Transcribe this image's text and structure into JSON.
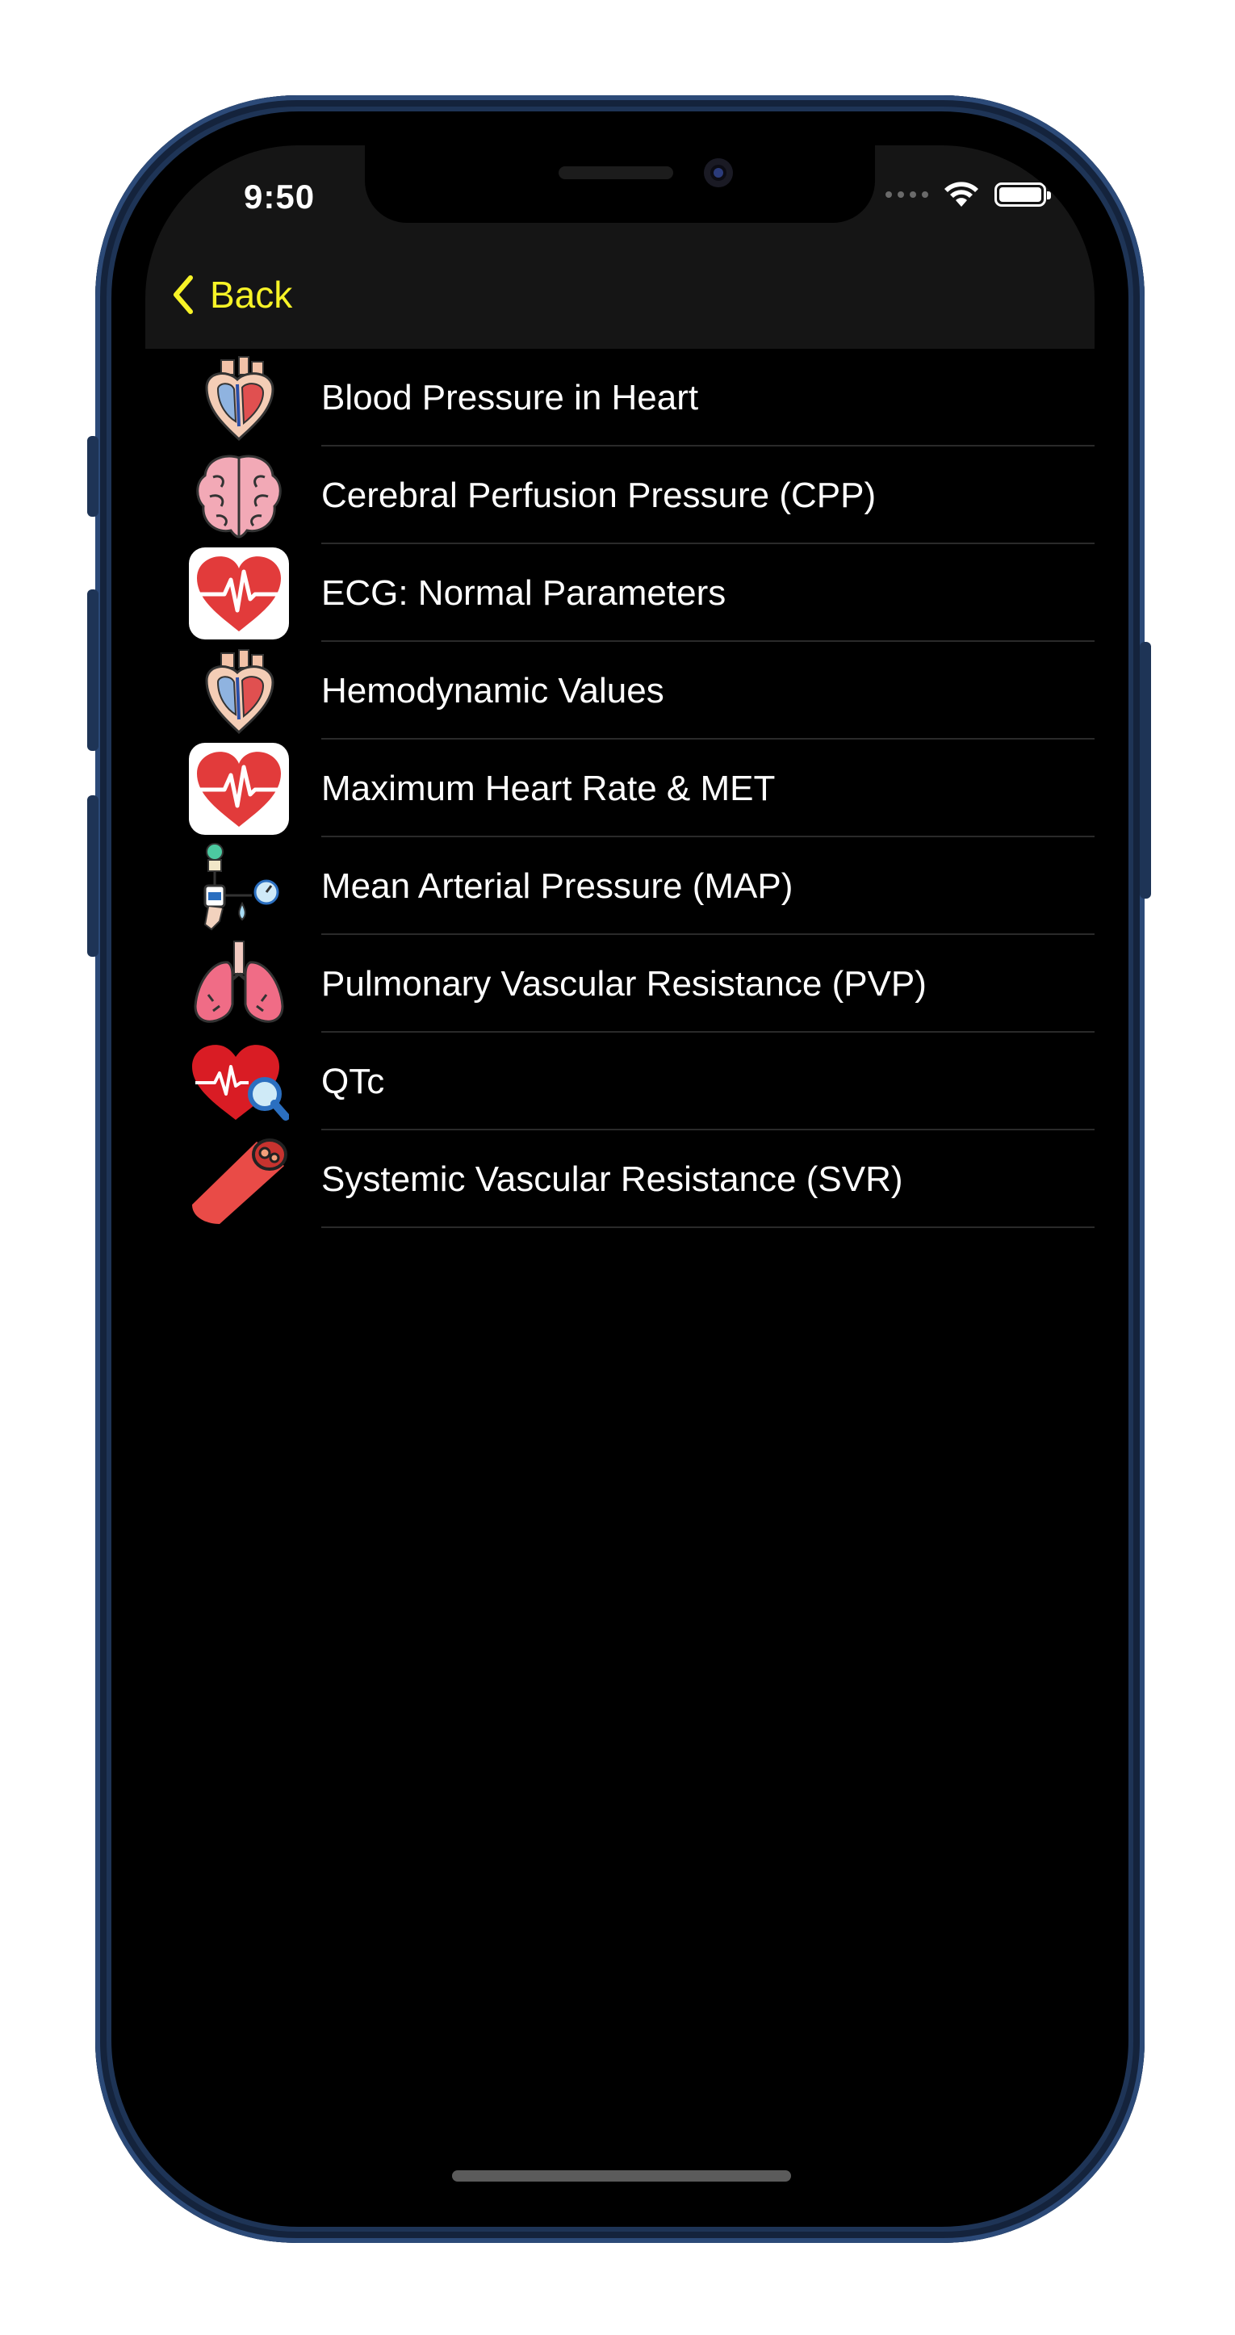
{
  "status_bar": {
    "time": "9:50"
  },
  "nav": {
    "back_label": "Back"
  },
  "colors": {
    "accent": "#f7f327",
    "background": "#000000",
    "bar": "#151515",
    "separator": "#2a2a2a"
  },
  "list": {
    "items": [
      {
        "label": "Blood Pressure in Heart",
        "icon": "heart-anatomy-icon"
      },
      {
        "label": "Cerebral Perfusion Pressure (CPP)",
        "icon": "brain-icon"
      },
      {
        "label": "ECG: Normal Parameters",
        "icon": "heart-ecg-icon"
      },
      {
        "label": "Hemodynamic Values",
        "icon": "heart-anatomy-icon"
      },
      {
        "label": "Maximum Heart Rate & MET",
        "icon": "heart-ecg-icon"
      },
      {
        "label": "Mean Arterial Pressure (MAP)",
        "icon": "blood-pressure-cuff-icon"
      },
      {
        "label": "Pulmonary Vascular Resistance (PVP)",
        "icon": "lungs-icon"
      },
      {
        "label": "QTc",
        "icon": "heart-magnifier-icon"
      },
      {
        "label": "Systemic Vascular Resistance (SVR)",
        "icon": "blood-vessel-icon"
      }
    ]
  }
}
